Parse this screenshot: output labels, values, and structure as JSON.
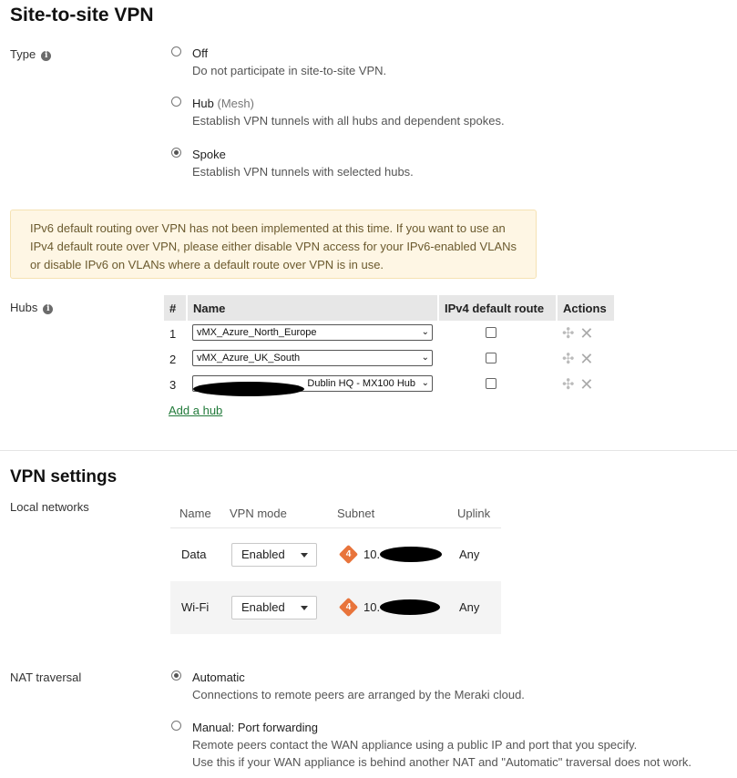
{
  "page": {
    "title": "Site-to-site VPN"
  },
  "type": {
    "label": "Type",
    "options": [
      {
        "title": "Off",
        "suffix": "",
        "description": "Do not participate in site-to-site VPN.",
        "checked": false
      },
      {
        "title": "Hub",
        "suffix": "(Mesh)",
        "description": "Establish VPN tunnels with all hubs and dependent spokes.",
        "checked": false
      },
      {
        "title": "Spoke",
        "suffix": "",
        "description": "Establish VPN tunnels with selected hubs.",
        "checked": true
      }
    ]
  },
  "alert": {
    "text": "IPv6 default routing over VPN has not been implemented at this time. If you want to use an IPv4 default route over VPN, please either disable VPN access for your IPv6-enabled VLANs or disable IPv6 on VLANs where a default route over VPN is in use."
  },
  "hubs": {
    "label": "Hubs",
    "columns": [
      "#",
      "Name",
      "IPv4 default route",
      "Actions"
    ],
    "rows": [
      {
        "num": "1",
        "name": "vMX_Azure_North_Europe",
        "default_route": false
      },
      {
        "num": "2",
        "name": "vMX_Azure_UK_South",
        "default_route": false
      },
      {
        "num": "3",
        "name": "Dublin HQ - MX100 Hub",
        "default_route": false
      }
    ],
    "add_link": "Add a hub"
  },
  "vpn_settings": {
    "title": "VPN settings",
    "local_networks_label": "Local networks",
    "columns": [
      "Name",
      "VPN mode",
      "Subnet",
      "Uplink"
    ],
    "rows": [
      {
        "name": "Data",
        "mode": "Enabled",
        "ip_badge": "4",
        "subnet": "10.",
        "uplink": "Any"
      },
      {
        "name": "Wi-Fi",
        "mode": "Enabled",
        "ip_badge": "4",
        "subnet": "10.",
        "uplink": "Any"
      }
    ]
  },
  "nat": {
    "label": "NAT traversal",
    "options": [
      {
        "title": "Automatic",
        "description": "Connections to remote peers are arranged by the Meraki cloud.",
        "checked": true
      },
      {
        "title": "Manual: Port forwarding",
        "description": "Remote peers contact the WAN appliance using a public IP and port that you specify.",
        "description2": "Use this if your WAN appliance is behind another NAT and \"Automatic\" traversal does not work.",
        "checked": false
      }
    ]
  },
  "colors": {
    "link": "#217a3a",
    "alert_bg": "#fef6e4",
    "ipv4_badge": "#e8743b"
  },
  "icons": {
    "info": "info-icon",
    "move": "move-icon",
    "delete": "close-icon"
  }
}
